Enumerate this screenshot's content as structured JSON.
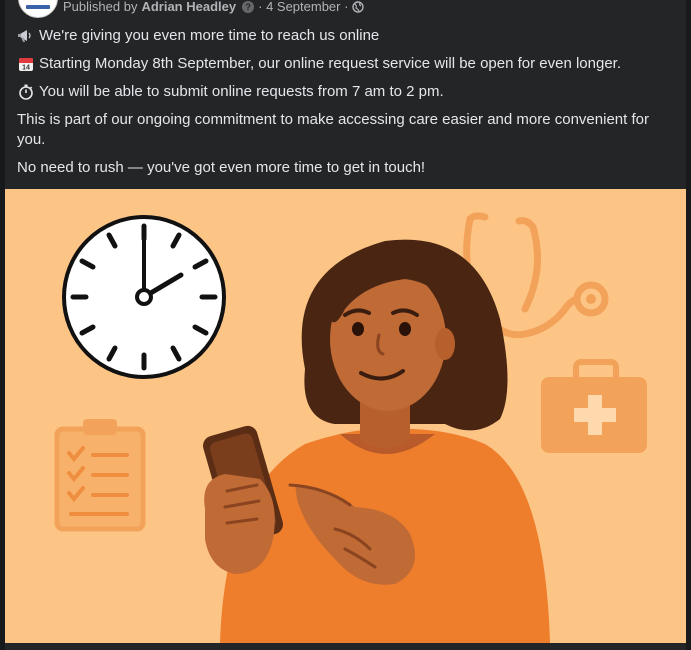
{
  "header": {
    "published_prefix": "Published by",
    "author": "Adrian Headley",
    "date": "4 September"
  },
  "post": {
    "lines": [
      {
        "icon": "megaphone-icon",
        "text": "We're giving you even more time to reach us online"
      },
      {
        "icon": "calendar-icon",
        "text": "Starting Monday 8th September, our online request service will be open for even longer."
      },
      {
        "icon": "stopwatch-icon",
        "text": "You will be able to submit online requests from 7 am to 2 pm."
      }
    ],
    "paragraph_1": "This is part of our ongoing commitment to make accessing care easier and more convenient for you.",
    "paragraph_2": "No need to rush — you've got even more time to get in touch!",
    "calendar_day": "14"
  },
  "illustration": {
    "background_color": "#fdc585",
    "accent_color": "#ee7e2c",
    "icons": [
      "clock-icon",
      "stethoscope-icon",
      "first-aid-kit-icon",
      "clipboard-checklist-icon",
      "smartphone-icon"
    ]
  }
}
